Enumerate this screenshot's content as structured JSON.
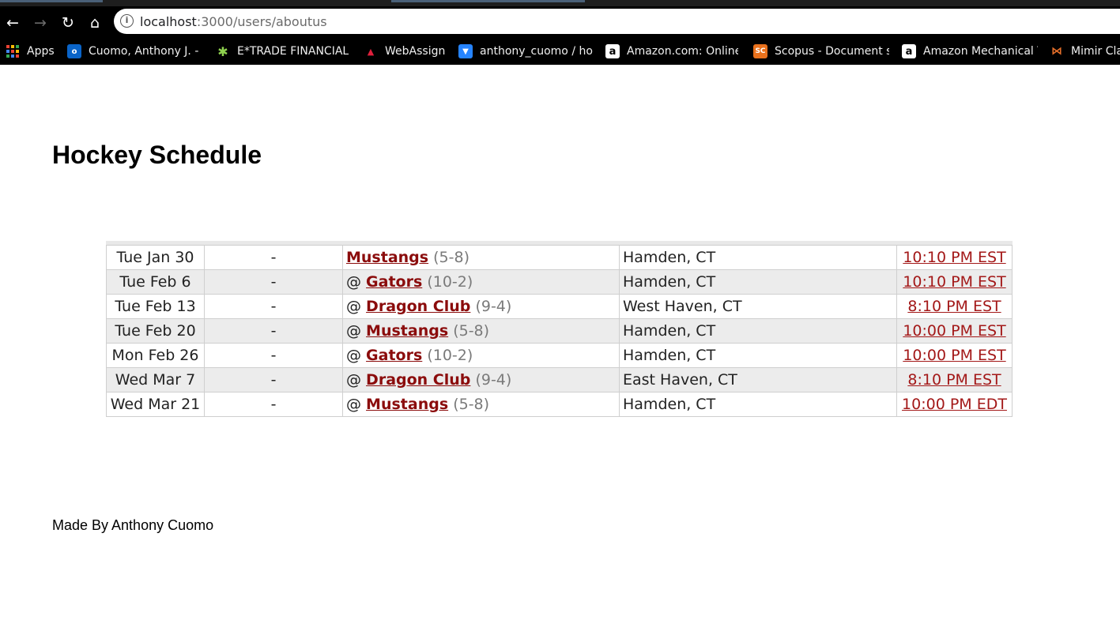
{
  "browser": {
    "url_host": "localhost",
    "url_path": ":3000/users/aboutus",
    "bookmarks": [
      {
        "label": "Apps",
        "icon": "apps-grid-icon"
      },
      {
        "label": "Cuomo, Anthony J. -",
        "icon": "outlook-icon",
        "color": "#0a64c8"
      },
      {
        "label": "E*TRADE FINANCIAL",
        "icon": "etrade-icon",
        "color": "#6b3fa0"
      },
      {
        "label": "WebAssign",
        "icon": "webassign-icon",
        "color": "#c0142c"
      },
      {
        "label": "anthony_cuomo / ho",
        "icon": "bitbucket-icon",
        "color": "#2684ff"
      },
      {
        "label": "Amazon.com: Online",
        "icon": "amazon-icon",
        "color": "#ffffff"
      },
      {
        "label": "Scopus - Document s",
        "icon": "scopus-icon",
        "color": "#e9711c"
      },
      {
        "label": "Amazon Mechanical T",
        "icon": "amazon-icon",
        "color": "#ffffff"
      },
      {
        "label": "Mimir Cla",
        "icon": "mimir-icon",
        "color": "#e8702a"
      }
    ]
  },
  "page": {
    "title": "Hockey Schedule",
    "footer": "Made By Anthony Cuomo"
  },
  "schedule": {
    "rows": [
      {
        "date": "Tue Jan 30",
        "score": "-",
        "at": "",
        "team": "Mustangs",
        "record": "(5-8)",
        "location": "Hamden, CT",
        "time": "10:10 PM EST"
      },
      {
        "date": "Tue Feb 6",
        "score": "-",
        "at": "@",
        "team": "Gators",
        "record": "(10-2)",
        "location": "Hamden, CT",
        "time": "10:10 PM EST"
      },
      {
        "date": "Tue Feb 13",
        "score": "-",
        "at": "@",
        "team": "Dragon Club",
        "record": "(9-4)",
        "location": "West Haven, CT",
        "time": "8:10 PM EST"
      },
      {
        "date": "Tue Feb 20",
        "score": "-",
        "at": "@",
        "team": "Mustangs",
        "record": "(5-8)",
        "location": "Hamden, CT",
        "time": "10:00 PM EST"
      },
      {
        "date": "Mon Feb 26",
        "score": "-",
        "at": "@",
        "team": "Gators",
        "record": "(10-2)",
        "location": "Hamden, CT",
        "time": "10:00 PM EST"
      },
      {
        "date": "Wed Mar 7",
        "score": "-",
        "at": "@",
        "team": "Dragon Club",
        "record": "(9-4)",
        "location": "East Haven, CT",
        "time": "8:10 PM EST"
      },
      {
        "date": "Wed Mar 21",
        "score": "-",
        "at": "@",
        "team": "Mustangs",
        "record": "(5-8)",
        "location": "Hamden, CT",
        "time": "10:00 PM EDT"
      }
    ]
  },
  "colors": {
    "team_link": "#8b0c0c",
    "time_link": "#a31818",
    "row_alt": "#ececec"
  }
}
